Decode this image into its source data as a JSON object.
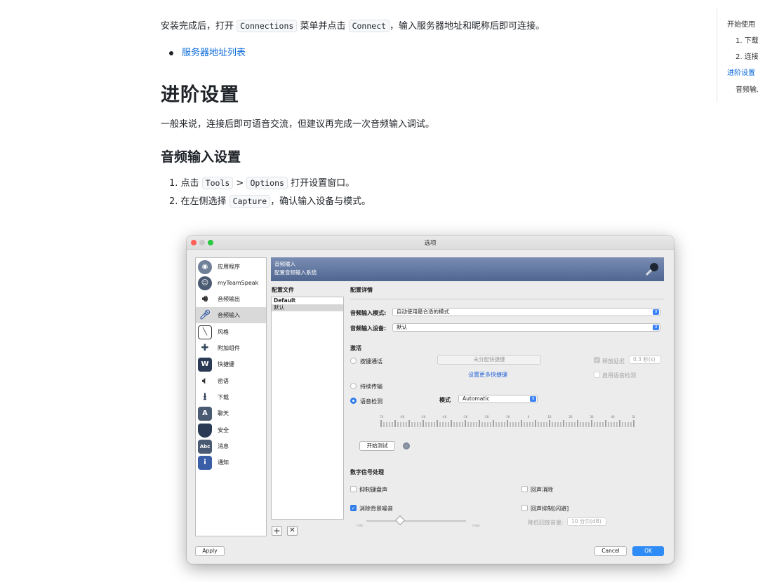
{
  "article": {
    "p1_before": "安装完成后，打开 ",
    "p1_code1": "Connections",
    "p1_mid": " 菜单并点击 ",
    "p1_code2": "Connect",
    "p1_after": "，输入服务器地址和昵称后即可连接。",
    "link_server_list": "服务器地址列表",
    "h2": "进阶设置",
    "p2": "一般来说，连接后即可语音交流，但建议再完成一次音频输入调试。",
    "h3": "音频输入设置",
    "step1_pre": "1. 点击 ",
    "step1_code1": "Tools",
    "step1_sep": " > ",
    "step1_code2": "Options",
    "step1_post": " 打开设置窗口。",
    "step2_pre": "2. 在左侧选择 ",
    "step2_code": "Capture",
    "step2_post": "，确认输入设备与模式。"
  },
  "toc": {
    "items": [
      "开始使用",
      "1. 下载",
      "2. 连接",
      "进阶设置",
      "音频输入"
    ]
  },
  "window": {
    "title": "选项",
    "sidebar": [
      "应用程序",
      "myTeamSpeak",
      "音频输出",
      "音频输入",
      "风格",
      "附加组件",
      "快捷键",
      "密语",
      "下载",
      "聊天",
      "安全",
      "消息",
      "通知"
    ],
    "header_line1": "音频输入",
    "header_line2": "配置音频输入系统",
    "profiles_label": "配置文件",
    "profiles": [
      "Default",
      "默认"
    ],
    "details_label": "配置详情",
    "mode_label": "音频输入模式:",
    "mode_value": "自动使用最合适的模式",
    "device_label": "音频输入设备:",
    "device_value": "默认",
    "activation_label": "激活",
    "ptt_label": "按键通话",
    "hotkey_btn": "未分配快捷键",
    "more_hotkeys": "设置更多快捷键",
    "release_delay_label": "释放延迟",
    "release_delay_value": "0.3 秒(s)",
    "enable_vad_label": "启用语音检测",
    "continuous_label": "持续传输",
    "vad_label": "语音检测",
    "mode_short_label": "模式",
    "vad_mode_value": "Automatic",
    "ruler_ticks": [
      "-70",
      "-60",
      "-50",
      "-40",
      "-30",
      "-20",
      "-10",
      "0",
      "10",
      "20",
      "30",
      "40",
      "50"
    ],
    "start_test_btn": "开始测试",
    "dsp_label": "数字信号处理",
    "suppress_keyboard": "抑制键盘声",
    "echo_cancel": "回声消除",
    "remove_noise": "消除背景噪音",
    "echo_suppress": "回声抑制[闪避]",
    "reduce_volume_label": "降低回放音量:",
    "reduce_volume_value": "10 分贝(dB)",
    "slider_min": "min",
    "slider_max": "max",
    "apply_btn": "Apply",
    "cancel_btn": "Cancel",
    "ok_btn": "OK"
  }
}
